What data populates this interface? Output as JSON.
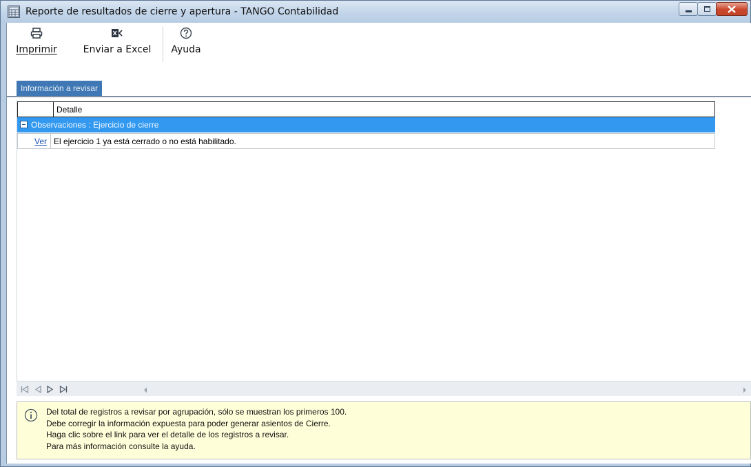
{
  "window": {
    "title": "Reporte de resultados de cierre y apertura - TANGO Contabilidad",
    "icon": "report-grid-icon",
    "controls": [
      "minimize",
      "maximize",
      "close"
    ]
  },
  "toolbar": {
    "print_label": "Imprimir",
    "excel_label": "Enviar a Excel",
    "help_label": "Ayuda",
    "icons": {
      "print": "printer-icon",
      "excel": "excel-icon",
      "help": "help-icon"
    }
  },
  "tab": {
    "label": "Información a revisar"
  },
  "grid": {
    "columns": [
      "",
      "Detalle"
    ],
    "group": {
      "label": "Observaciones : Ejercicio de cierre"
    },
    "rows": [
      {
        "link": "Ver",
        "detail": "El ejercicio 1 ya está cerrado o no está habilitado."
      }
    ]
  },
  "colors": {
    "tab_bg": "#3f78b4",
    "group_row_bg": "#3399f0",
    "link": "#1f56b8",
    "info_bg": "#fefed9"
  },
  "info": {
    "lines": [
      "Del total de registros a revisar por agrupación, sólo se muestran los primeros 100.",
      "Debe corregir la información expuesta para poder generar asientos de Cierre.",
      "Haga clic sobre el link para ver el detalle de los registros a revisar.",
      "Para más información consulte la ayuda."
    ]
  }
}
